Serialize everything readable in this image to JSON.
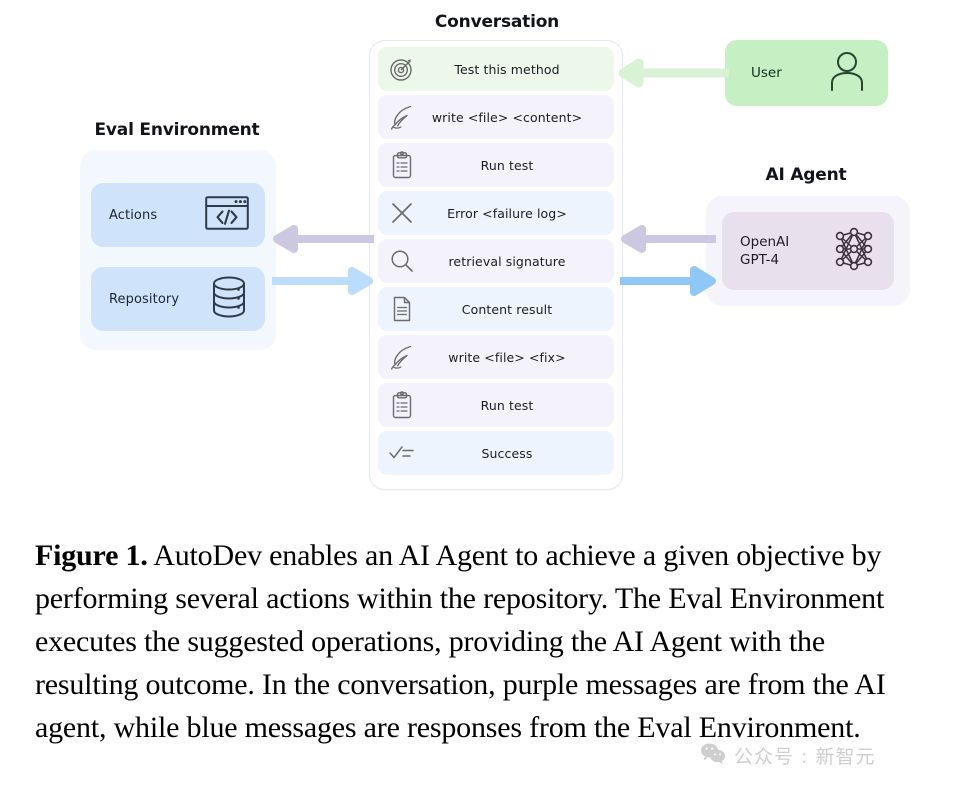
{
  "figure": {
    "conversation": {
      "title": "Conversation",
      "messages": [
        {
          "icon": "target-icon",
          "text": "Test this method",
          "tone": "green"
        },
        {
          "icon": "quill-pen-icon",
          "text": "write <file> <content>",
          "tone": "purple"
        },
        {
          "icon": "clipboard-icon",
          "text": "Run test",
          "tone": "purple"
        },
        {
          "icon": "x-cross-icon",
          "text": "Error <failure log>",
          "tone": "blue"
        },
        {
          "icon": "magnifier-icon",
          "text": "retrieval signature",
          "tone": "purple"
        },
        {
          "icon": "document-icon",
          "text": "Content result",
          "tone": "blue"
        },
        {
          "icon": "quill-pen-icon",
          "text": "write <file> <fix>",
          "tone": "purple"
        },
        {
          "icon": "clipboard-icon",
          "text": "Run test",
          "tone": "purple"
        },
        {
          "icon": "check-list-icon",
          "text": "Success",
          "tone": "blue"
        }
      ]
    },
    "eval_environment": {
      "title": "Eval Environment",
      "cards": [
        {
          "label": "Actions",
          "icon": "code-window-icon"
        },
        {
          "label": "Repository",
          "icon": "database-icon"
        }
      ]
    },
    "user": {
      "label": "User",
      "icon": "person-icon"
    },
    "ai_agent": {
      "title": "AI Agent",
      "model_label": "OpenAI\nGPT-4",
      "icon": "neural-network-icon"
    },
    "arrows": [
      {
        "name": "user-to-conversation",
        "direction": "left",
        "color": "#d9f2d6"
      },
      {
        "name": "conversation-to-eval",
        "direction": "left",
        "color": "#cdc8e2"
      },
      {
        "name": "eval-to-conversation",
        "direction": "right",
        "color": "#bcdcfb"
      },
      {
        "name": "agent-to-conversation",
        "direction": "left",
        "color": "#cdc8e2"
      },
      {
        "name": "conversation-to-agent",
        "direction": "right",
        "color": "#8fc8f7"
      }
    ],
    "colors": {
      "green_message": "#ecf8ea",
      "purple_message": "#f4f3fb",
      "blue_message": "#eef4fd",
      "eval_card": "#cfe4fa",
      "eval_outer": "#f3f8fe",
      "user_box": "#c6efc4",
      "agent_card": "#e9e0ee",
      "agent_outer": "#f6f4fb"
    }
  },
  "caption": {
    "figure_label": "Figure 1.",
    "body": " AutoDev enables an AI Agent to achieve a given objective by performing several actions within the repository. The Eval Environment executes the suggested operations, providing the AI Agent with the resulting outcome. In the conversation, purple messages are from the AI agent, while blue messages are responses from the Eval Environment."
  },
  "watermark": {
    "text": "公众号 : 新智元",
    "icon": "wechat-logo-icon"
  }
}
